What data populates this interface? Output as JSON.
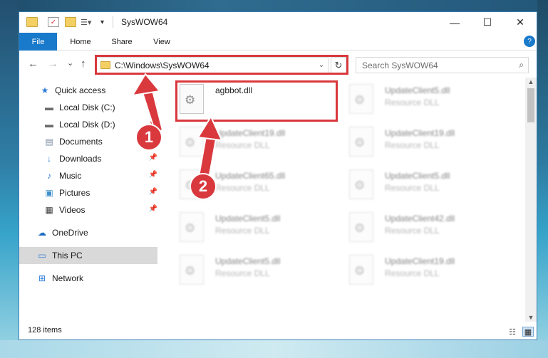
{
  "window": {
    "title": "SysWOW64",
    "minimize_glyph": "—",
    "maximize_glyph": "☐",
    "close_glyph": "✕"
  },
  "ribbon": {
    "tabs": [
      "File",
      "Home",
      "Share",
      "View"
    ],
    "expand_glyph": "?"
  },
  "navigation": {
    "back_glyph": "←",
    "forward_glyph": "→",
    "recent_glyph": "⌄",
    "up_glyph": "↑",
    "address_path": "C:\\Windows\\SysWOW64",
    "address_dropdown_glyph": "⌄",
    "refresh_glyph": "↻",
    "search_placeholder": "Search SysWOW64",
    "search_glyph": "⌕"
  },
  "nav_pane": {
    "items": [
      {
        "label": "Quick access",
        "icon": "star-icon",
        "glyph": "★",
        "color": "#2f7ed8",
        "pinned": false
      },
      {
        "label": "Local Disk (C:)",
        "icon": "drive-icon",
        "glyph": "▬",
        "color": "#6b6b6b",
        "pinned": true
      },
      {
        "label": "Local Disk (D:)",
        "icon": "drive-icon",
        "glyph": "▬",
        "color": "#6b6b6b",
        "pinned": true
      },
      {
        "label": "Documents",
        "icon": "documents-icon",
        "glyph": "▤",
        "color": "#7a8aa0",
        "pinned": true
      },
      {
        "label": "Downloads",
        "icon": "download-icon",
        "glyph": "↓",
        "color": "#2f7ed8",
        "pinned": true
      },
      {
        "label": "Music",
        "icon": "music-icon",
        "glyph": "♪",
        "color": "#2f7ed8",
        "pinned": true
      },
      {
        "label": "Pictures",
        "icon": "pictures-icon",
        "glyph": "▣",
        "color": "#3f8fc9",
        "pinned": true
      },
      {
        "label": "Videos",
        "icon": "videos-icon",
        "glyph": "▦",
        "color": "#3b3b3b",
        "pinned": true
      },
      {
        "label": "OneDrive",
        "icon": "cloud-icon",
        "glyph": "☁",
        "color": "#1f6fc0",
        "pinned": false
      },
      {
        "label": "This PC",
        "icon": "computer-icon",
        "glyph": "▭",
        "color": "#2f7ed8",
        "pinned": false
      },
      {
        "label": "Network",
        "icon": "network-icon",
        "glyph": "⊞",
        "color": "#2f7ed8",
        "pinned": false
      }
    ],
    "pin_glyph": "📌"
  },
  "files": [
    {
      "name": "agbbot.dll",
      "type": ""
    },
    {
      "name": "UpdateClient5.dll",
      "type": "Resource DLL"
    },
    {
      "name": "UpdateClient19.dll",
      "type": "Resource DLL"
    },
    {
      "name": "UpdateClient19.dll",
      "type": "Resource DLL"
    },
    {
      "name": "UpdateClient65.dll",
      "type": "Resource DLL"
    },
    {
      "name": "UpdateClient5.dll",
      "type": "Resource DLL"
    },
    {
      "name": "UpdateClient5.dll",
      "type": "Resource DLL"
    },
    {
      "name": "UpdateClient42.dll",
      "type": "Resource DLL"
    },
    {
      "name": "UpdateClient5.dll",
      "type": "Resource DLL"
    },
    {
      "name": "UpdateClient19.dll",
      "type": "Resource DLL"
    }
  ],
  "status": {
    "item_count": "128 items"
  },
  "callouts": {
    "step1": "1",
    "step2": "2",
    "color": "#d9383d"
  },
  "colors": {
    "accent": "#1979ca",
    "highlight_red": "#d9383d"
  }
}
